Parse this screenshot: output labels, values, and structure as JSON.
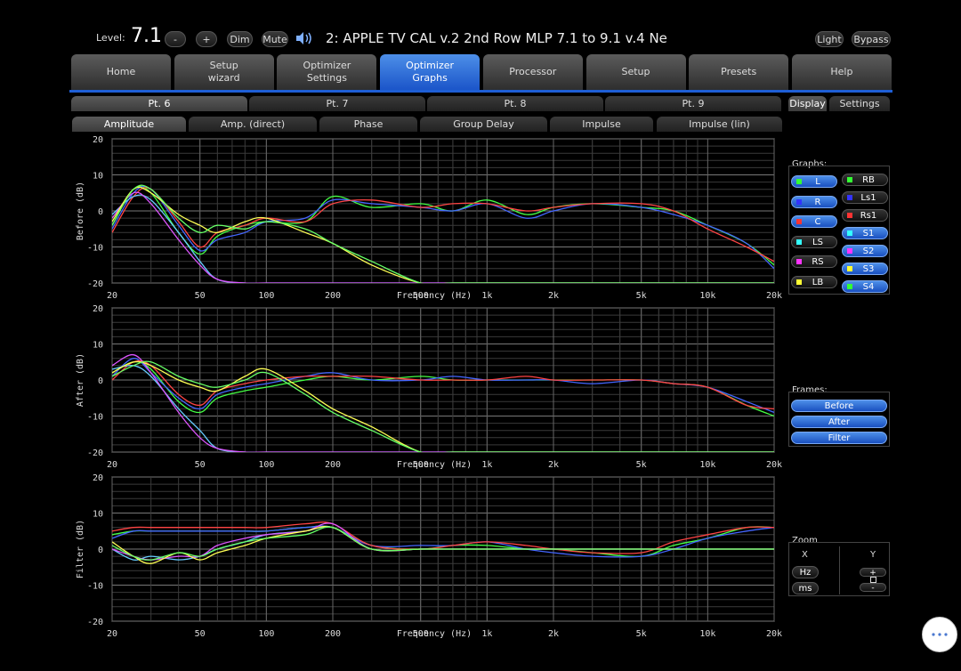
{
  "header": {
    "level_label": "Level:",
    "level_value": "7.1",
    "minus": "-",
    "plus": "+",
    "dim": "Dim",
    "mute": "Mute",
    "title": "2: APPLE TV CAL v.2 2nd Row MLP 7.1 to 9.1 v.4 Ne",
    "light": "Light",
    "bypass": "Bypass"
  },
  "tabs": [
    {
      "l1": "Home",
      "l2": ""
    },
    {
      "l1": "Setup",
      "l2": "wizard"
    },
    {
      "l1": "Optimizer",
      "l2": "Settings"
    },
    {
      "l1": "Optimizer",
      "l2": "Graphs"
    },
    {
      "l1": "Processor",
      "l2": ""
    },
    {
      "l1": "Setup",
      "l2": ""
    },
    {
      "l1": "Presets",
      "l2": ""
    },
    {
      "l1": "Help",
      "l2": ""
    }
  ],
  "points": [
    "Pt. 6",
    "Pt. 7",
    "Pt. 8",
    "Pt. 9"
  ],
  "graph_tabs": [
    "Amplitude",
    "Amp. (direct)",
    "Phase",
    "Group Delay",
    "Impulse",
    "Impulse (lin)"
  ],
  "side_tabs": [
    "Display",
    "Settings"
  ],
  "graphs_panel": {
    "title": "Graphs:",
    "channels": [
      {
        "label": "L",
        "color": "#33ff33",
        "on": true
      },
      {
        "label": "R",
        "color": "#3333ff",
        "on": true
      },
      {
        "label": "C",
        "color": "#ff3333",
        "on": true
      },
      {
        "label": "LS",
        "color": "#33ffff",
        "on": false
      },
      {
        "label": "RS",
        "color": "#ff33ff",
        "on": false
      },
      {
        "label": "LB",
        "color": "#ffff33",
        "on": false
      },
      {
        "label": "RB",
        "color": "#33ff33",
        "on": false
      },
      {
        "label": "Ls1",
        "color": "#3333ff",
        "on": false
      },
      {
        "label": "Rs1",
        "color": "#ff3333",
        "on": false
      },
      {
        "label": "S1",
        "color": "#33ffff",
        "on": true
      },
      {
        "label": "S2",
        "color": "#ff33ff",
        "on": true
      },
      {
        "label": "S3",
        "color": "#ffff33",
        "on": true
      },
      {
        "label": "S4",
        "color": "#33ff33",
        "on": true
      }
    ]
  },
  "frames_panel": {
    "title": "Frames:",
    "items": [
      "Before",
      "After",
      "Filter"
    ]
  },
  "zoom_panel": {
    "title": "Zoom",
    "x_label": "X",
    "y_label": "Y",
    "x_buttons": [
      "Hz",
      "ms"
    ],
    "y_buttons": [
      "+",
      "-"
    ]
  },
  "plots": [
    {
      "ylabel": "Before (dB)"
    },
    {
      "ylabel": "After (dB)"
    },
    {
      "ylabel": "Filter (dB)"
    }
  ],
  "axis": {
    "xlabel": "Frequency (Hz)",
    "xticks": [
      "20",
      "50",
      "100",
      "200",
      "500",
      "1k",
      "2k",
      "5k",
      "10k",
      "20k"
    ],
    "yticks": [
      "20",
      "10",
      "0",
      "-10",
      "-20"
    ]
  },
  "chart_data": [
    {
      "type": "line",
      "title": "",
      "xlabel": "Frequency (Hz)",
      "ylabel": "Before (dB)",
      "x_scale": "log",
      "xlim": [
        20,
        20000
      ],
      "ylim": [
        -20,
        20
      ],
      "x": [
        20,
        25,
        30,
        40,
        50,
        60,
        80,
        100,
        150,
        200,
        300,
        500,
        700,
        1000,
        1500,
        2000,
        3000,
        5000,
        7000,
        10000,
        15000,
        20000
      ],
      "series": [
        {
          "name": "L",
          "color": "#44ff44",
          "values": [
            -4,
            6,
            5,
            -6,
            -12,
            -7,
            -4,
            -3,
            -3,
            4,
            1,
            2,
            0,
            3,
            -1,
            1,
            2,
            1,
            0,
            -4,
            -9,
            -15
          ]
        },
        {
          "name": "R",
          "color": "#4466ff",
          "values": [
            -5,
            5,
            6,
            -4,
            -11,
            -8,
            -6,
            -3,
            -2,
            3,
            2,
            1,
            0,
            2,
            -2,
            0,
            2,
            1,
            -1,
            -4,
            -9,
            -16
          ]
        },
        {
          "name": "C",
          "color": "#ff4444",
          "values": [
            -6,
            4,
            6,
            -3,
            -10,
            -6,
            -4,
            -2,
            -3,
            2,
            3,
            1,
            2,
            2,
            0,
            1,
            2,
            2,
            0,
            -5,
            -10,
            -14
          ]
        },
        {
          "name": "S1",
          "color": "#66ccff",
          "values": [
            -1,
            4,
            3,
            -6,
            -14,
            -19,
            -20,
            -20,
            -20,
            -20,
            -20,
            -20,
            -20,
            -20,
            -20,
            -20,
            -20,
            -20,
            -20,
            -20,
            -20,
            -20
          ]
        },
        {
          "name": "S2",
          "color": "#dd55ff",
          "values": [
            -2,
            5,
            2,
            -8,
            -15,
            -19,
            -20,
            -20,
            -20,
            -20,
            -20,
            -20,
            -20,
            -20,
            -20,
            -20,
            -20,
            -20,
            -20,
            -20,
            -20,
            -20
          ]
        },
        {
          "name": "S3",
          "color": "#ffff55",
          "values": [
            -3,
            6,
            5,
            -1,
            -4,
            -6,
            -3,
            -2,
            -6,
            -9,
            -15,
            -20,
            -20,
            -20,
            -20,
            -20,
            -20,
            -20,
            -20,
            -20,
            -20,
            -20
          ]
        },
        {
          "name": "S4",
          "color": "#66ff66",
          "values": [
            -4,
            6,
            6,
            -2,
            -6,
            -4,
            -5,
            -3,
            -5,
            -9,
            -14,
            -20,
            -20,
            -20,
            -20,
            -20,
            -20,
            -20,
            -20,
            -20,
            -20,
            -20
          ]
        }
      ]
    },
    {
      "type": "line",
      "title": "",
      "xlabel": "Frequency (Hz)",
      "ylabel": "After (dB)",
      "x_scale": "log",
      "xlim": [
        20,
        20000
      ],
      "ylim": [
        -20,
        20
      ],
      "x": [
        20,
        25,
        30,
        40,
        50,
        60,
        80,
        100,
        150,
        200,
        300,
        500,
        700,
        1000,
        1500,
        2000,
        3000,
        5000,
        7000,
        10000,
        15000,
        20000
      ],
      "series": [
        {
          "name": "L",
          "color": "#44ff44",
          "values": [
            2,
            5,
            3,
            -6,
            -9,
            -5,
            -3,
            -2,
            0,
            1,
            0,
            1,
            0,
            0,
            0,
            0,
            0,
            0,
            -1,
            -2,
            -7,
            -10
          ]
        },
        {
          "name": "R",
          "color": "#4466ff",
          "values": [
            1,
            6,
            2,
            -5,
            -8,
            -4,
            -2,
            -1,
            1,
            2,
            0,
            0,
            1,
            0,
            0,
            0,
            -1,
            0,
            -1,
            -2,
            -6,
            -9
          ]
        },
        {
          "name": "C",
          "color": "#ff4444",
          "values": [
            0,
            5,
            4,
            -4,
            -7,
            -3,
            -1,
            0,
            1,
            1,
            1,
            0,
            0,
            0,
            1,
            0,
            0,
            0,
            -1,
            -2,
            -7,
            -8
          ]
        },
        {
          "name": "S1",
          "color": "#66ccff",
          "values": [
            3,
            4,
            1,
            -8,
            -14,
            -19,
            -20,
            -20,
            -20,
            -20,
            -20,
            -20,
            -20,
            -20,
            -20,
            -20,
            -20,
            -20,
            -20,
            -20,
            -20,
            -20
          ]
        },
        {
          "name": "S2",
          "color": "#dd55ff",
          "values": [
            4,
            7,
            2,
            -9,
            -16,
            -19,
            -20,
            -20,
            -20,
            -20,
            -20,
            -20,
            -20,
            -20,
            -20,
            -20,
            -20,
            -20,
            -20,
            -20,
            -20,
            -20
          ]
        },
        {
          "name": "S3",
          "color": "#ffff55",
          "values": [
            2,
            5,
            4,
            0,
            -2,
            -3,
            1,
            3,
            -3,
            -8,
            -13,
            -20,
            -20,
            -20,
            -20,
            -20,
            -20,
            -20,
            -20,
            -20,
            -20,
            -20
          ]
        },
        {
          "name": "S4",
          "color": "#66ff66",
          "values": [
            1,
            4,
            5,
            1,
            -1,
            -2,
            0,
            2,
            -4,
            -9,
            -14,
            -20,
            -20,
            -20,
            -20,
            -20,
            -20,
            -20,
            -20,
            -20,
            -20,
            -20
          ]
        }
      ]
    },
    {
      "type": "line",
      "title": "",
      "xlabel": "Frequency (Hz)",
      "ylabel": "Filter (dB)",
      "x_scale": "log",
      "xlim": [
        20,
        20000
      ],
      "ylim": [
        -20,
        20
      ],
      "x": [
        20,
        25,
        30,
        40,
        50,
        60,
        80,
        100,
        150,
        200,
        300,
        500,
        700,
        1000,
        1500,
        2000,
        3000,
        5000,
        7000,
        10000,
        15000,
        20000
      ],
      "series": [
        {
          "name": "L",
          "color": "#44ff44",
          "values": [
            4,
            5,
            5,
            5,
            5,
            5,
            5,
            5,
            6,
            6,
            1,
            0,
            1,
            1,
            0,
            0,
            -1,
            -2,
            1,
            3,
            6,
            6
          ]
        },
        {
          "name": "R",
          "color": "#4466ff",
          "values": [
            3,
            5,
            5,
            5,
            5,
            5,
            5,
            5,
            6,
            6,
            1,
            1,
            1,
            2,
            0,
            -1,
            -2,
            -2,
            0,
            3,
            5,
            6
          ]
        },
        {
          "name": "C",
          "color": "#ff4444",
          "values": [
            5,
            6,
            6,
            6,
            6,
            6,
            6,
            6,
            7,
            7,
            1,
            0,
            1,
            2,
            1,
            0,
            -1,
            -1,
            2,
            4,
            6,
            6
          ]
        },
        {
          "name": "S1",
          "color": "#66ccff",
          "values": [
            0,
            -3,
            -2,
            -3,
            -2,
            0,
            2,
            4,
            5,
            6,
            0,
            0,
            0,
            0,
            0,
            0,
            0,
            0,
            0,
            0,
            0,
            0
          ]
        },
        {
          "name": "S2",
          "color": "#dd55ff",
          "values": [
            0,
            -2,
            -3,
            -2,
            -2,
            1,
            3,
            4,
            5,
            7,
            0,
            0,
            0,
            0,
            0,
            0,
            0,
            0,
            0,
            0,
            0,
            0
          ]
        },
        {
          "name": "S3",
          "color": "#ffff55",
          "values": [
            2,
            -2,
            -4,
            -1,
            -3,
            -1,
            1,
            3,
            5,
            6,
            0,
            0,
            0,
            0,
            0,
            0,
            0,
            0,
            0,
            0,
            0,
            0
          ]
        },
        {
          "name": "S4",
          "color": "#66ff66",
          "values": [
            1,
            -2,
            -3,
            -1,
            -2,
            0,
            2,
            3,
            4,
            6,
            0,
            0,
            0,
            0,
            0,
            0,
            0,
            0,
            0,
            0,
            0,
            0
          ]
        }
      ]
    }
  ]
}
